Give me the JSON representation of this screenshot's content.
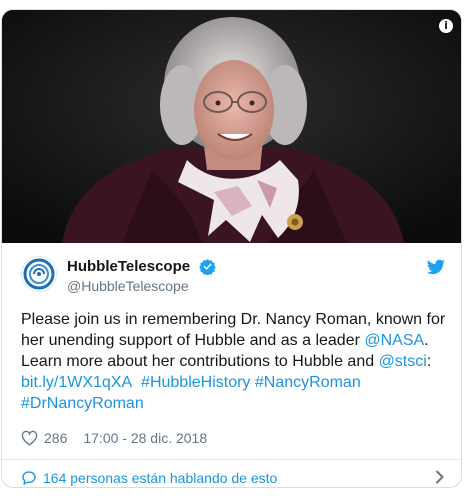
{
  "media": {
    "info_icon": "info-icon",
    "info_glyph": "i"
  },
  "author": {
    "display_name": "HubbleTelescope",
    "handle": "@HubbleTelescope",
    "avatar_icon": "hubble-logo-avatar",
    "verified_icon": "verified-badge-icon",
    "platform_icon": "twitter-bird-icon"
  },
  "tweet": {
    "text_1": "Please join us in remembering Dr. Nancy Roman, known for her unending support of Hubble and as a leader ",
    "mention_nasa": "@NASA",
    "text_2": ". Learn more about her contributions to Hubble and ",
    "mention_stsci": "@stsci",
    "text_3": ": ",
    "link": "bit.ly/1WX1qXA",
    "hashtag_1": "#HubbleHistory",
    "hashtag_2": "#NancyRoman",
    "hashtag_3": "#DrNancyRoman"
  },
  "meta": {
    "like_count": "286",
    "timestamp": "17:00 - 28 dic. 2018",
    "like_icon": "heart-icon"
  },
  "footer": {
    "conversation_text": "164 personas están hablando de esto",
    "bubble_icon": "speech-bubble-icon",
    "chevron_icon": "chevron-right-icon"
  },
  "colors": {
    "link": "#1b95e0",
    "text": "#14171a",
    "muted": "#657786",
    "border": "#e1e8ed",
    "media_bg": "#141414"
  }
}
